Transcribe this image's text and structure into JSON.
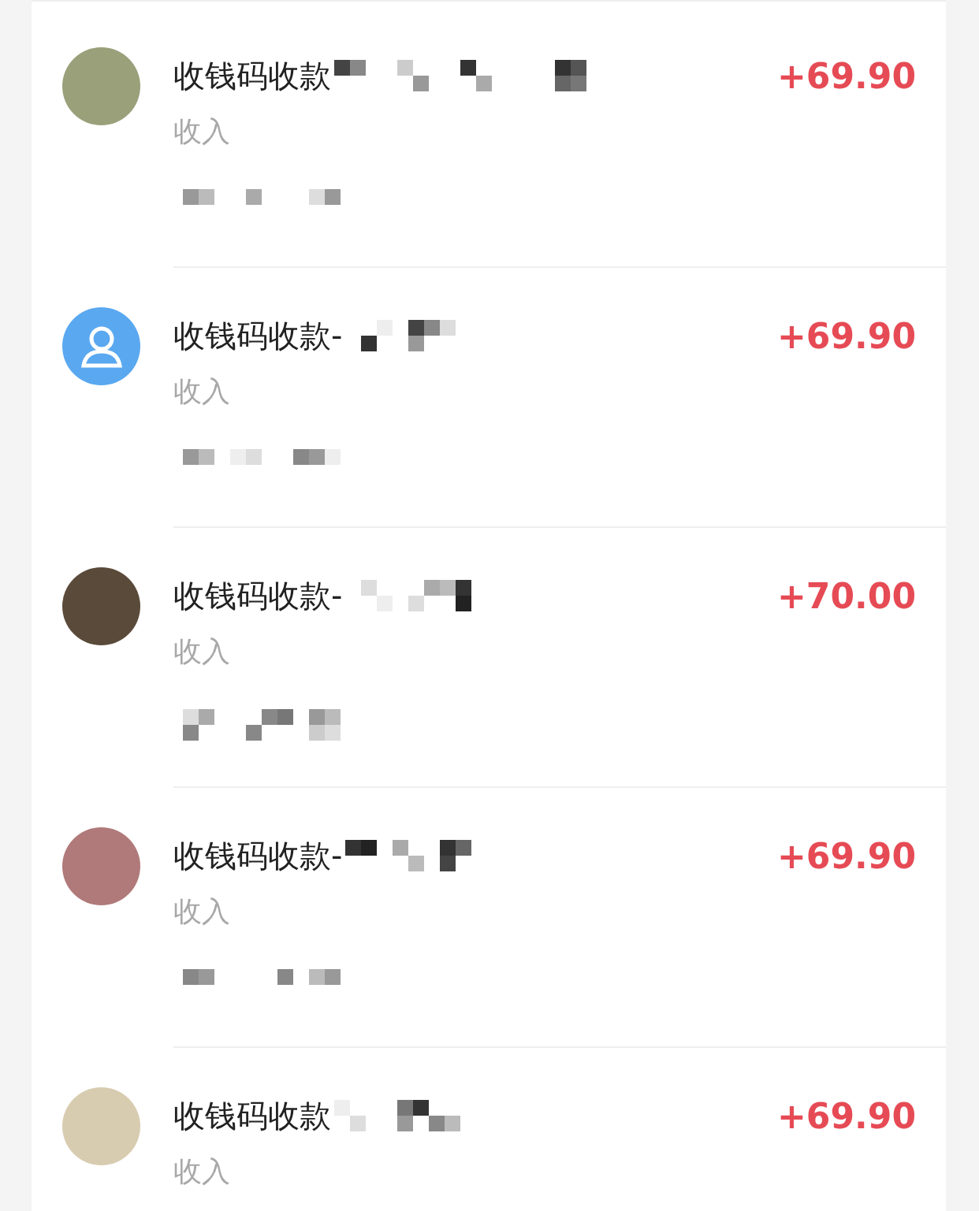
{
  "transactions": [
    {
      "avatar": {
        "kind": "photo"
      },
      "title": "收钱码收款",
      "amount": "+69.90",
      "type": "收入"
    },
    {
      "avatar": {
        "kind": "default"
      },
      "title": "收钱码收款-",
      "amount": "+69.90",
      "type": "收入"
    },
    {
      "avatar": {
        "kind": "photo"
      },
      "title": "收钱码收款-",
      "amount": "+70.00",
      "type": "收入"
    },
    {
      "avatar": {
        "kind": "photo"
      },
      "title": "收钱码收款-",
      "amount": "+69.90",
      "type": "收入"
    },
    {
      "avatar": {
        "kind": "photo"
      },
      "title": "收钱码收款",
      "amount": "+69.90",
      "type": "收入"
    }
  ]
}
